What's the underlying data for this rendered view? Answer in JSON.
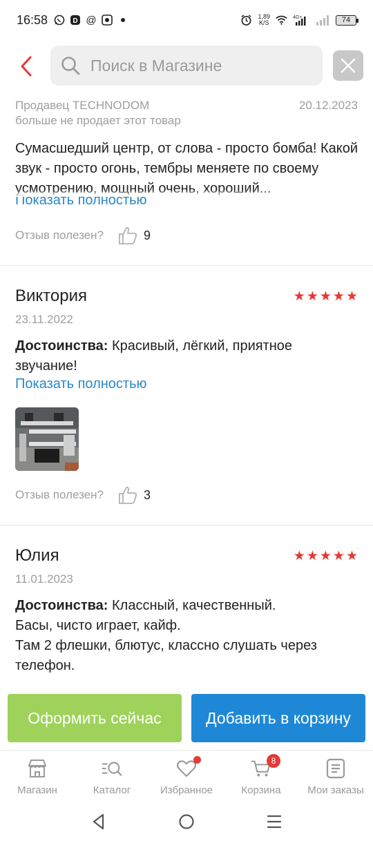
{
  "status_bar": {
    "time": "16:58",
    "speed_value": "1,89",
    "speed_unit": "K/S",
    "network": "4G+",
    "battery": "74"
  },
  "search": {
    "placeholder": "Поиск в Магазине"
  },
  "reviews": [
    {
      "seller_label": "Продавец TECHNODOM",
      "date": "20.12.2023",
      "seller_note": "больше не продает этот товар",
      "text": "Сумасшедший центр, от слова - просто бомба! Какой звук - просто огонь, тембры меняете по своему усмотрению, мощный очень, хороший...",
      "show_more": "Показать полностью",
      "helpful_label": "Отзыв полезен?",
      "helpful_count": "9"
    },
    {
      "name": "Виктория",
      "rating": 5,
      "date": "23.11.2022",
      "advantages_label": "Достоинства:",
      "advantages_text": " Красивый, лёгкий, приятное звучание!",
      "show_more": "Показать полностью",
      "helpful_label": "Отзыв полезен?",
      "helpful_count": "3"
    },
    {
      "name": "Юлия",
      "rating": 5,
      "date": "11.01.2023",
      "advantages_label": "Достоинства:",
      "advantages_line1": " Классный, качественный.",
      "advantages_line2": "Басы, чисто играет, кайф.",
      "advantages_line3": "Там 2 флешки, блютус, классно слушать через телефон."
    }
  ],
  "actions": {
    "order_now": "Оформить сейчас",
    "add_to_cart": "Добавить в корзину"
  },
  "bottom_nav": {
    "items": [
      {
        "label": "Магазин",
        "icon": "store-icon"
      },
      {
        "label": "Каталог",
        "icon": "catalog-search-icon"
      },
      {
        "label": "Избранное",
        "icon": "heart-icon"
      },
      {
        "label": "Корзина",
        "icon": "cart-icon",
        "badge": "8"
      },
      {
        "label": "Мои заказы",
        "icon": "orders-icon"
      }
    ]
  },
  "colors": {
    "accent_red": "#e53935",
    "link_blue": "#2a87c9",
    "order_green": "#9ed25a",
    "cart_blue": "#1e88d6"
  }
}
